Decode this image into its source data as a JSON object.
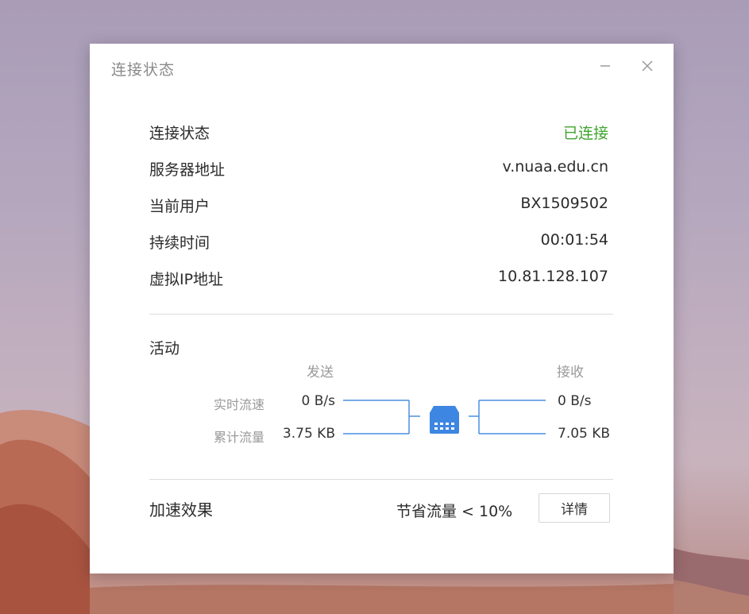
{
  "window": {
    "title": "连接状态",
    "minimize_icon": "minimize-icon",
    "close_icon": "close-icon"
  },
  "status": {
    "rows": [
      {
        "label": "连接状态",
        "value": "已连接"
      },
      {
        "label": "服务器地址",
        "value": "v.nuaa.edu.cn"
      },
      {
        "label": "当前用户",
        "value": "BX1509502"
      },
      {
        "label": "持续时间",
        "value": "00:01:54"
      },
      {
        "label": "虚拟IP地址",
        "value": "10.81.128.107"
      }
    ],
    "connected_color": "#3fa52e"
  },
  "activity": {
    "title": "活动",
    "send_header": "发送",
    "receive_header": "接收",
    "speed_label": "实时流速",
    "total_label": "累计流量",
    "send_speed": "0 B/s",
    "send_total": "3.75 KB",
    "receive_speed": "0 B/s",
    "receive_total": "7.05 KB",
    "device_icon": "router-icon",
    "line_color": "#4a8fe0"
  },
  "acceleration": {
    "title": "加速效果",
    "value": "节省流量 < 10%",
    "details_button": "详情"
  }
}
